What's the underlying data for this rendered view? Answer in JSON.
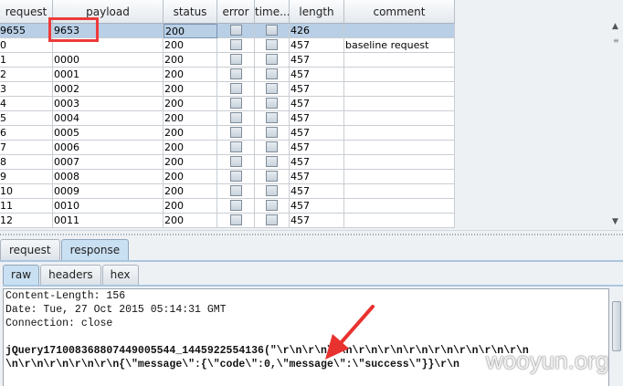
{
  "table": {
    "columns": [
      "request",
      "payload",
      "status",
      "error",
      "time...",
      "length",
      "comment"
    ],
    "rows": [
      {
        "request": "9655",
        "payload": "9653",
        "status": "200",
        "length": "426",
        "comment": ""
      },
      {
        "request": "0",
        "payload": "",
        "status": "200",
        "length": "457",
        "comment": "baseline request"
      },
      {
        "request": "1",
        "payload": "0000",
        "status": "200",
        "length": "457",
        "comment": ""
      },
      {
        "request": "2",
        "payload": "0001",
        "status": "200",
        "length": "457",
        "comment": ""
      },
      {
        "request": "3",
        "payload": "0002",
        "status": "200",
        "length": "457",
        "comment": ""
      },
      {
        "request": "4",
        "payload": "0003",
        "status": "200",
        "length": "457",
        "comment": ""
      },
      {
        "request": "5",
        "payload": "0004",
        "status": "200",
        "length": "457",
        "comment": ""
      },
      {
        "request": "6",
        "payload": "0005",
        "status": "200",
        "length": "457",
        "comment": ""
      },
      {
        "request": "7",
        "payload": "0006",
        "status": "200",
        "length": "457",
        "comment": ""
      },
      {
        "request": "8",
        "payload": "0007",
        "status": "200",
        "length": "457",
        "comment": ""
      },
      {
        "request": "9",
        "payload": "0008",
        "status": "200",
        "length": "457",
        "comment": ""
      },
      {
        "request": "10",
        "payload": "0009",
        "status": "200",
        "length": "457",
        "comment": ""
      },
      {
        "request": "11",
        "payload": "0010",
        "status": "200",
        "length": "457",
        "comment": ""
      },
      {
        "request": "12",
        "payload": "0011",
        "status": "200",
        "length": "457",
        "comment": ""
      }
    ]
  },
  "tabs": {
    "request": "request",
    "response": "response"
  },
  "subtabs": {
    "raw": "raw",
    "headers": "headers",
    "hex": "hex"
  },
  "response": {
    "lines": [
      "Content-Length: 156",
      "Date: Tue, 27 Oct 2015 05:14:31 GMT",
      "Connection: close",
      "",
      "jQuery171008368807449005544_1445922554136(\"\\r\\n\\r\\n\\r\\n\\r\\n\\r\\n\\r\\n\\r\\n\\r\\n\\r\\n\\r\\n",
      "\\n\\r\\n\\r\\n\\r\\n\\r\\n{\\\"message\\\":{\\\"code\\\":0,\\\"message\\\":\\\"success\\\"}}\\r\\n"
    ]
  },
  "watermark": "wooyun.org",
  "colors": {
    "selected_row": "#b8cfe5",
    "highlight": "#ee3b3b",
    "annotation_arrow": "#e8322f"
  }
}
